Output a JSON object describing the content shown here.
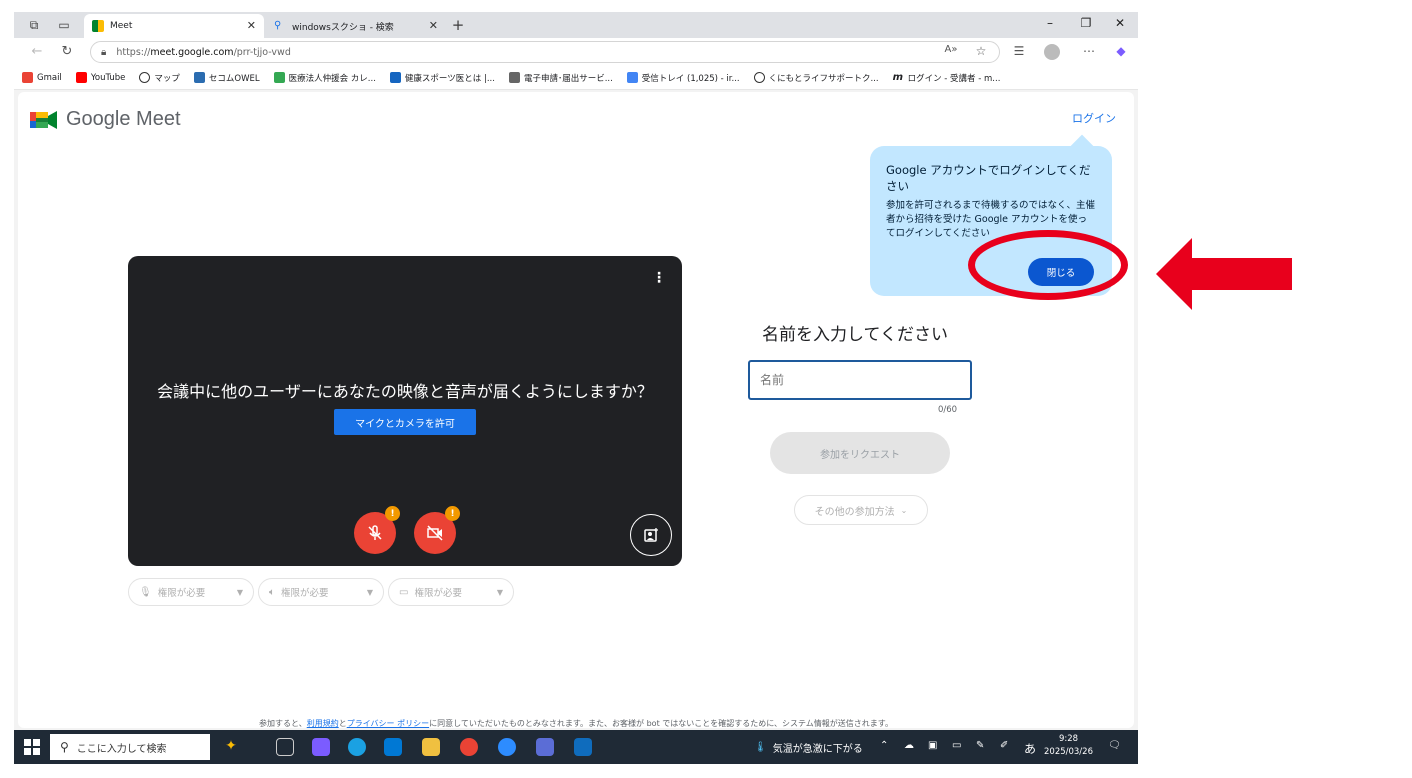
{
  "browser": {
    "tabs": [
      {
        "label": "Meet",
        "active": true
      },
      {
        "label": "windowsスクショ - 検索",
        "active": false
      }
    ],
    "url_prefix": "https://",
    "url_host": "meet.google.com",
    "url_path": "/prr-tjjo-vwd",
    "bookmarks": [
      "Gmail",
      "YouTube",
      "マップ",
      "セコムOWEL",
      "医療法人仲援会 カレ...",
      "健康スポーツ医とは |...",
      "電子申請･届出サービ...",
      "受信トレイ (1,025) - ir...",
      "くにもとライフサポートク...",
      "ログイン - 受講者 - m..."
    ]
  },
  "header": {
    "logo_text": "Google Meet",
    "login_label": "ログイン"
  },
  "popup": {
    "title": "Google アカウントでログインしてください",
    "body": "参加を許可されるまで待機するのではなく、主催者から招待を受けた Google アカウントを使ってログインしてください",
    "close_label": "閉じる"
  },
  "video": {
    "question": "会議中に他のユーザーにあなたの映像と音声が届くようにしますか？",
    "allow_label": "マイクとカメラを許可",
    "badge": "!"
  },
  "permissions": [
    {
      "label": "権限が必要",
      "icon": "mic-icon"
    },
    {
      "label": "権限が必要",
      "icon": "speaker-icon"
    },
    {
      "label": "権限が必要",
      "icon": "camera-icon"
    }
  ],
  "form": {
    "heading": "名前を入力してください",
    "name_placeholder": "名前",
    "counter": "0/60",
    "join_label": "参加をリクエスト",
    "other_label": "その他の参加方法"
  },
  "footer": {
    "prefix": "参加すると、",
    "terms": "利用規約",
    "and": "と",
    "privacy": "プライバシー ポリシー",
    "suffix": "に同意していただいたものとみなされます。また、お客様が bot ではないことを確認するために、システム情報が送信されます。"
  },
  "taskbar": {
    "search_placeholder": "ここに入力して検索",
    "weather": "気温が急激に下がる",
    "ime": "あ",
    "time": "9:28",
    "date": "2025/03/26"
  },
  "colors": {
    "accent": "#1a73e8",
    "popup_bg": "#c2e7ff",
    "annotation_red": "#e8001c"
  }
}
